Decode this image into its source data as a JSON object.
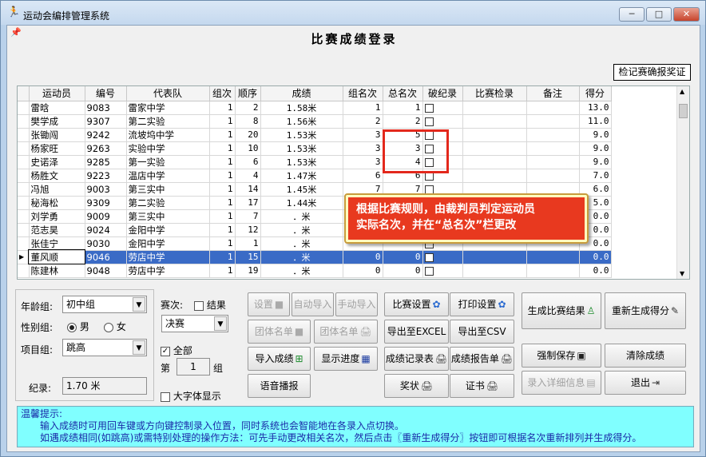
{
  "window": {
    "title": "运动会编排管理系统",
    "minimize": "─",
    "maximize": "□",
    "close": "✕"
  },
  "page_title": "比赛成绩登录",
  "award_button": "检记赛确报奖证",
  "table": {
    "columns": [
      "运动员",
      "编号",
      "代表队",
      "组次",
      "顺序",
      "成绩",
      "组名次",
      "总名次",
      "破纪录",
      "比赛检录",
      "备注",
      "得分"
    ],
    "rows": [
      {
        "athlete": "雷晗",
        "id": "9083",
        "team": "雷家中学",
        "group": "1",
        "order": "2",
        "result": "1.58米",
        "group_rank": "1",
        "total_rank": "1",
        "notes": "",
        "score": "13.0"
      },
      {
        "athlete": "樊学成",
        "id": "9307",
        "team": "第二实验",
        "group": "1",
        "order": "8",
        "result": "1.56米",
        "group_rank": "2",
        "total_rank": "2",
        "notes": "",
        "score": "11.0"
      },
      {
        "athlete": "张锄闯",
        "id": "9242",
        "team": "流坡坞中学",
        "group": "1",
        "order": "20",
        "result": "1.53米",
        "group_rank": "3",
        "total_rank": "5",
        "notes": "",
        "score": "9.0"
      },
      {
        "athlete": "杨家旺",
        "id": "9263",
        "team": "实验中学",
        "group": "1",
        "order": "10",
        "result": "1.53米",
        "group_rank": "3",
        "total_rank": "3",
        "notes": "",
        "score": "9.0"
      },
      {
        "athlete": "史诺泽",
        "id": "9285",
        "team": "第一实验",
        "group": "1",
        "order": "6",
        "result": "1.53米",
        "group_rank": "3",
        "total_rank": "4",
        "notes": "",
        "score": "9.0"
      },
      {
        "athlete": "杨胜文",
        "id": "9223",
        "team": "温店中学",
        "group": "1",
        "order": "4",
        "result": "1.47米",
        "group_rank": "6",
        "total_rank": "6",
        "notes": "",
        "score": "7.0"
      },
      {
        "athlete": "冯旭",
        "id": "9003",
        "team": "第三实中",
        "group": "1",
        "order": "14",
        "result": "1.45米",
        "group_rank": "7",
        "total_rank": "7",
        "notes": "",
        "score": "6.0"
      },
      {
        "athlete": "秘海松",
        "id": "9309",
        "team": "第二实验",
        "group": "1",
        "order": "17",
        "result": "1.44米",
        "group_rank": "",
        "total_rank": "",
        "notes": "",
        "score": "5.0"
      },
      {
        "athlete": "刘学勇",
        "id": "9009",
        "team": "第三实中",
        "group": "1",
        "order": "7",
        "result": "．米",
        "group_rank": "",
        "total_rank": "",
        "notes": "",
        "score": "0.0"
      },
      {
        "athlete": "范志昊",
        "id": "9024",
        "team": "金阳中学",
        "group": "1",
        "order": "12",
        "result": "．米",
        "group_rank": "",
        "total_rank": "",
        "notes": "",
        "score": "0.0"
      },
      {
        "athlete": "张佳宁",
        "id": "9030",
        "team": "金阳中学",
        "group": "1",
        "order": "1",
        "result": "．米",
        "group_rank": "",
        "total_rank": "",
        "notes": "",
        "score": "0.0"
      },
      {
        "athlete": "董风顺",
        "id": "9046",
        "team": "劳店中学",
        "group": "1",
        "order": "15",
        "result": "．米",
        "group_rank": "0",
        "total_rank": "0",
        "notes": "",
        "score": "0.0"
      },
      {
        "athlete": "陈建林",
        "id": "9048",
        "team": "劳店中学",
        "group": "1",
        "order": "19",
        "result": "．米",
        "group_rank": "0",
        "total_rank": "0",
        "notes": "",
        "score": "0.0"
      }
    ]
  },
  "callout": {
    "line1": "根据比赛规则，由裁判员判定运动员",
    "line2": "实际名次，并在“总名次”栏更改"
  },
  "left_panel": {
    "age_label": "年龄组:",
    "age_value": "初中组",
    "gender_label": "性别组:",
    "male": "男",
    "female": "女",
    "event_label": "项目组:",
    "event_value": "跳高",
    "record_label": "纪录:",
    "record_value": "1.70 米"
  },
  "mid_panel": {
    "round_label": "赛次:",
    "result_check": "结果",
    "round_value": "决赛",
    "all_check": "全部",
    "group_prefix": "第",
    "group_value": "1",
    "group_suffix": "组",
    "bigfont_check": "大字体显示"
  },
  "buttons": {
    "settings": "设置",
    "auto_import": "自动导入",
    "manual_import": "手动导入",
    "team_list1": "团体名单",
    "team_list2": "团体名单",
    "import_results": "导入成绩",
    "show_progress": "显示进度",
    "voice": "语音播报",
    "match_settings": "比赛设置",
    "print_settings": "打印设置",
    "export_excel": "导出至EXCEL",
    "export_csv": "导出至CSV",
    "record_table": "成绩记录表",
    "report_sheet": "成绩报告单",
    "award": "奖状",
    "certificate": "证书",
    "gen_results": "生成比赛结果",
    "regen_score": "重新生成得分",
    "force_save": "强制保存",
    "clear_results": "清除成绩",
    "enter_detail": "录入详细信息",
    "exit": "退出"
  },
  "tips": {
    "title": "温馨提示:",
    "line1": "输入成绩时可用回车键或方向键控制录入位置，同时系统也会智能地在各录入点切换。",
    "line2": "如遇成绩相同(如跳高)或需特别处理的操作方法：可先手动更改相关名次，然后点击〖重新生成得分〗按钮即可根据名次重新排列并生成得分。"
  },
  "colors": {
    "selected_row": "#3a6bc6",
    "tips_bg": "#80ffff",
    "callout_bg": "#e8391f",
    "highlight_border": "#e3281c"
  }
}
